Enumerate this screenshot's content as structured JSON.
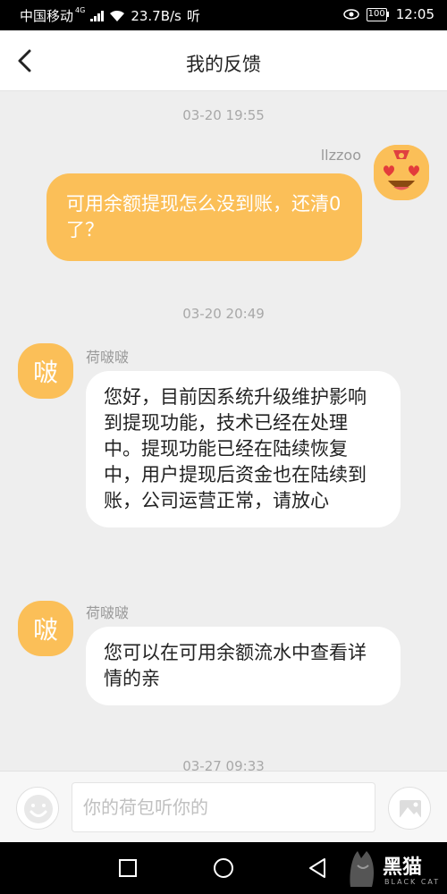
{
  "status_bar": {
    "carrier": "中国移动",
    "network": "4G",
    "speed": "23.7B/s",
    "extra": "听",
    "battery": "100",
    "time": "12:05"
  },
  "header": {
    "title": "我的反馈",
    "back_icon": "chevron-left-icon"
  },
  "messages": [
    {
      "timestamp": "03-20 19:55",
      "sender": "llzzoo",
      "direction": "out",
      "text": "可用余额提现怎么没到账，还清0了？"
    },
    {
      "timestamp": "03-20 20:49",
      "sender": "荷啵啵",
      "avatar_text": "啵",
      "direction": "in",
      "text": "您好，目前因系统升级维护影响到提现功能，技术已经在处理中。提现功能已经在陆续恢复中，用户提现后资金也在陆续到账，公司运营正常，请放心"
    },
    {
      "sender": "荷啵啵",
      "avatar_text": "啵",
      "direction": "in",
      "text": "您可以在可用余额流水中查看详情的亲"
    },
    {
      "timestamp": "03-27 09:33"
    }
  ],
  "input": {
    "placeholder": "你的荷包听你的",
    "emoji_icon": "emoji-icon",
    "image_icon": "image-icon"
  },
  "watermark": {
    "text": "黑猫",
    "subtext": "BLACK CAT"
  },
  "colors": {
    "accent": "#fbbf58",
    "background": "#eeeeee"
  }
}
